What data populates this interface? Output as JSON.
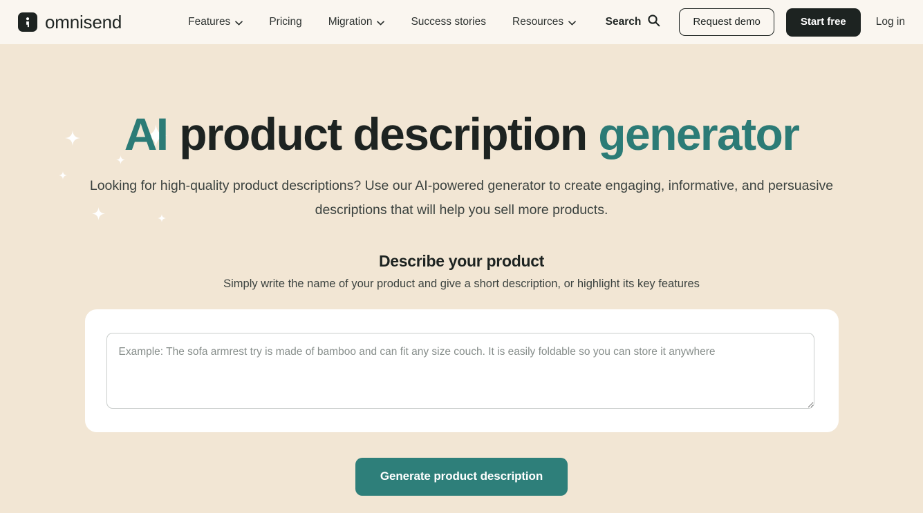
{
  "brand": {
    "name": "omnisend",
    "logo_icon": "omnisend-logo-icon"
  },
  "nav": {
    "items": [
      {
        "label": "Features",
        "has_dropdown": true
      },
      {
        "label": "Pricing",
        "has_dropdown": false
      },
      {
        "label": "Migration",
        "has_dropdown": true
      },
      {
        "label": "Success stories",
        "has_dropdown": false
      },
      {
        "label": "Resources",
        "has_dropdown": true
      }
    ]
  },
  "header_actions": {
    "search_label": "Search",
    "search_icon": "search-icon",
    "request_demo_label": "Request demo",
    "start_free_label": "Start free",
    "login_label": "Log in"
  },
  "hero": {
    "title_accent_start": "AI",
    "title_middle": " product description ",
    "title_accent_end": "generator",
    "subtitle": "Looking for high-quality product descriptions? Use our AI-powered generator to create engaging, informative, and persuasive descriptions that will help you sell more products."
  },
  "form": {
    "section_title": "Describe your product",
    "section_subtitle": "Simply write the name of your product and give a short description, or highlight its key features",
    "input_value": "",
    "input_placeholder": "Example: The sofa armrest try is made of bamboo and can fit any size couch. It is easily foldable so you can store it anywhere",
    "submit_label": "Generate product description"
  },
  "colors": {
    "accent_teal": "#2c7b76",
    "button_teal": "#2e7f7a",
    "dark": "#1d2321",
    "header_bg": "#faf6f0",
    "hero_bg": "#f2e6d4",
    "card_bg": "#ffffff"
  },
  "decorations": {
    "sparkle_icon": "sparkle-icon",
    "sparkle_color": "#ffffff"
  }
}
